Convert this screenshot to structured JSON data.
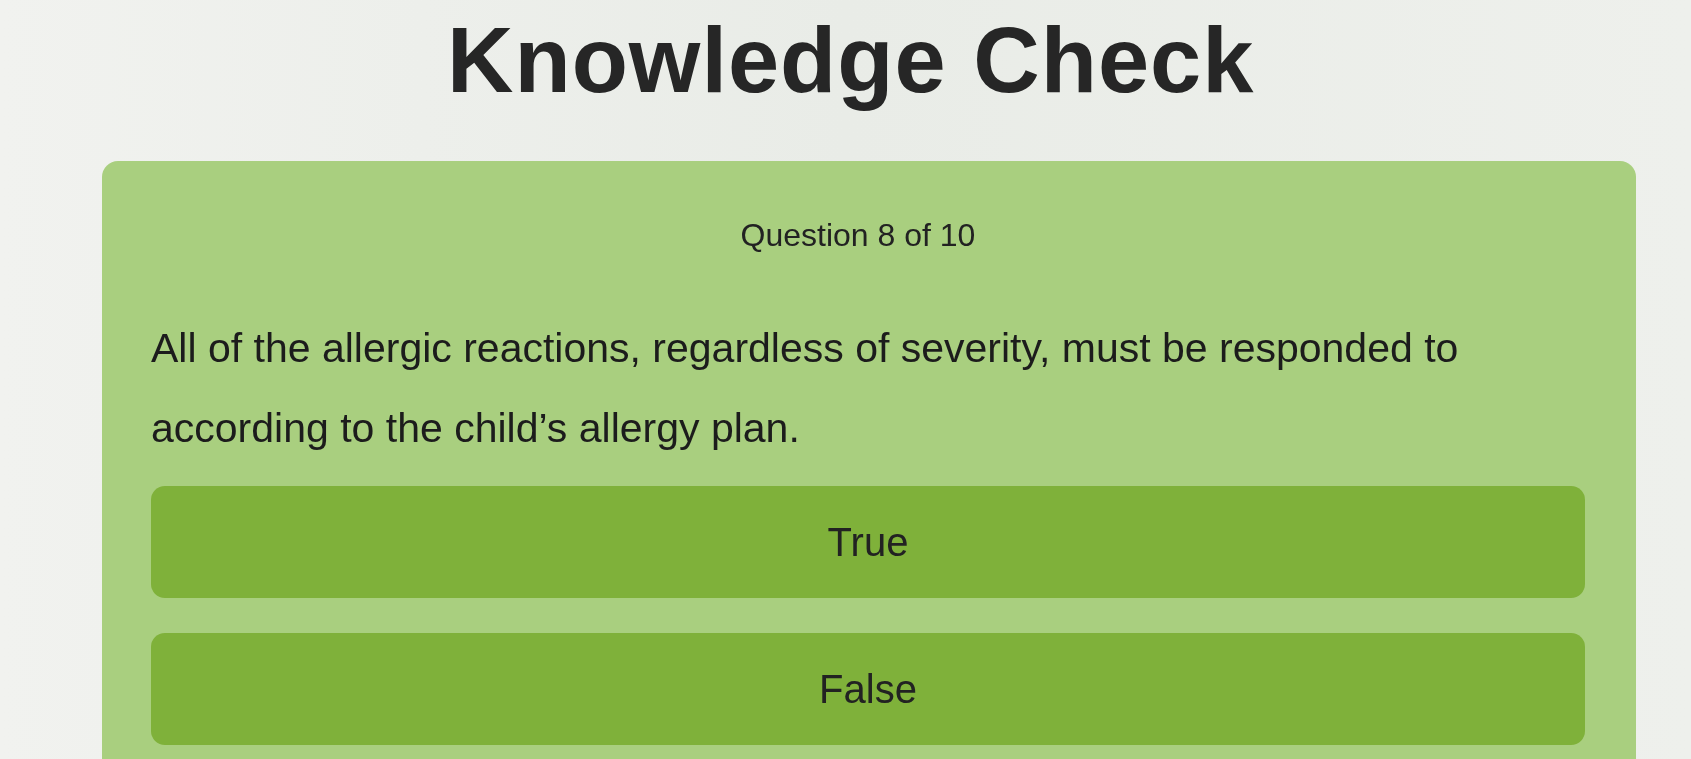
{
  "title": "Knowledge Check",
  "quiz": {
    "question_number": "Question 8 of 10",
    "question": "All of the allergic reactions, regardless of severity, must be responded to according to the child’s allergy plan.",
    "answers": [
      {
        "label": "True",
        "selected": false
      },
      {
        "label": "False",
        "selected": false
      }
    ]
  }
}
